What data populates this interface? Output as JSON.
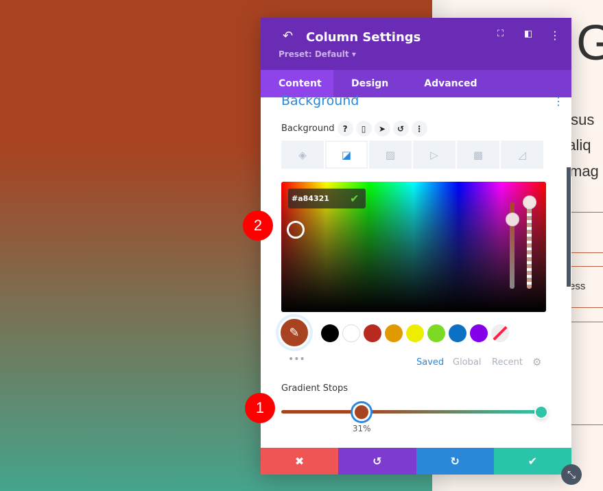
{
  "page": {
    "heading_fragment": "G",
    "lines": [
      "s sus",
      "t aliq",
      "mag",
      "ess"
    ]
  },
  "panel": {
    "title": "Column Settings",
    "preset": "Preset: Default ▾",
    "tabs": [
      "Content",
      "Design",
      "Advanced"
    ],
    "section": "Background",
    "field_label": "Background",
    "field_buttons": [
      "?",
      "▯",
      "➤",
      "↺",
      "⋮"
    ],
    "bg_types": [
      "color",
      "gradient",
      "image",
      "video",
      "pattern",
      "mask"
    ],
    "hex": "#a84321",
    "swatches": [
      "#000000",
      "#ffffff",
      "#b8291f",
      "#e09900",
      "#eded00",
      "#7cda24",
      "#0c71c3",
      "#8300e9",
      "transparent"
    ],
    "palette_tabs": [
      "Saved",
      "Global",
      "Recent"
    ],
    "gradient_label": "Gradient Stops",
    "stop_value": "31%",
    "stop_percent": 31,
    "gradient_colors": [
      "#a84321",
      "#2ec4a7"
    ],
    "footer": {
      "cancel": "✖",
      "undo": "↺",
      "redo": "↻",
      "save": "✔"
    }
  },
  "annotations": [
    "1",
    "2"
  ]
}
